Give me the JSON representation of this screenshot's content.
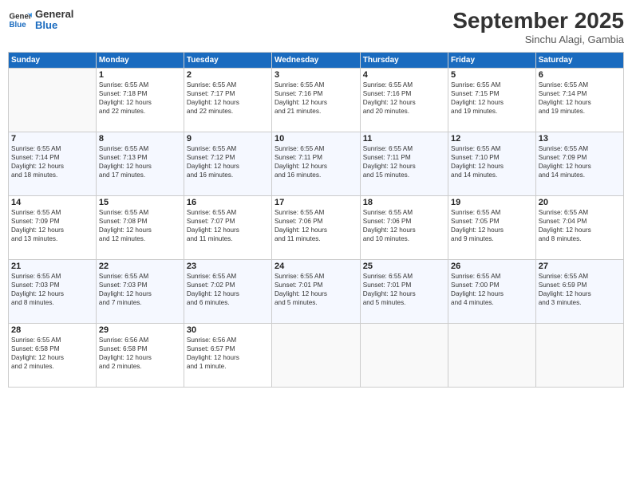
{
  "header": {
    "logo_line1": "General",
    "logo_line2": "Blue",
    "month": "September 2025",
    "location": "Sinchu Alagi, Gambia"
  },
  "weekdays": [
    "Sunday",
    "Monday",
    "Tuesday",
    "Wednesday",
    "Thursday",
    "Friday",
    "Saturday"
  ],
  "weeks": [
    [
      {
        "day": "",
        "info": ""
      },
      {
        "day": "1",
        "info": "Sunrise: 6:55 AM\nSunset: 7:18 PM\nDaylight: 12 hours\nand 22 minutes."
      },
      {
        "day": "2",
        "info": "Sunrise: 6:55 AM\nSunset: 7:17 PM\nDaylight: 12 hours\nand 22 minutes."
      },
      {
        "day": "3",
        "info": "Sunrise: 6:55 AM\nSunset: 7:16 PM\nDaylight: 12 hours\nand 21 minutes."
      },
      {
        "day": "4",
        "info": "Sunrise: 6:55 AM\nSunset: 7:16 PM\nDaylight: 12 hours\nand 20 minutes."
      },
      {
        "day": "5",
        "info": "Sunrise: 6:55 AM\nSunset: 7:15 PM\nDaylight: 12 hours\nand 19 minutes."
      },
      {
        "day": "6",
        "info": "Sunrise: 6:55 AM\nSunset: 7:14 PM\nDaylight: 12 hours\nand 19 minutes."
      }
    ],
    [
      {
        "day": "7",
        "info": "Sunrise: 6:55 AM\nSunset: 7:14 PM\nDaylight: 12 hours\nand 18 minutes."
      },
      {
        "day": "8",
        "info": "Sunrise: 6:55 AM\nSunset: 7:13 PM\nDaylight: 12 hours\nand 17 minutes."
      },
      {
        "day": "9",
        "info": "Sunrise: 6:55 AM\nSunset: 7:12 PM\nDaylight: 12 hours\nand 16 minutes."
      },
      {
        "day": "10",
        "info": "Sunrise: 6:55 AM\nSunset: 7:11 PM\nDaylight: 12 hours\nand 16 minutes."
      },
      {
        "day": "11",
        "info": "Sunrise: 6:55 AM\nSunset: 7:11 PM\nDaylight: 12 hours\nand 15 minutes."
      },
      {
        "day": "12",
        "info": "Sunrise: 6:55 AM\nSunset: 7:10 PM\nDaylight: 12 hours\nand 14 minutes."
      },
      {
        "day": "13",
        "info": "Sunrise: 6:55 AM\nSunset: 7:09 PM\nDaylight: 12 hours\nand 14 minutes."
      }
    ],
    [
      {
        "day": "14",
        "info": "Sunrise: 6:55 AM\nSunset: 7:09 PM\nDaylight: 12 hours\nand 13 minutes."
      },
      {
        "day": "15",
        "info": "Sunrise: 6:55 AM\nSunset: 7:08 PM\nDaylight: 12 hours\nand 12 minutes."
      },
      {
        "day": "16",
        "info": "Sunrise: 6:55 AM\nSunset: 7:07 PM\nDaylight: 12 hours\nand 11 minutes."
      },
      {
        "day": "17",
        "info": "Sunrise: 6:55 AM\nSunset: 7:06 PM\nDaylight: 12 hours\nand 11 minutes."
      },
      {
        "day": "18",
        "info": "Sunrise: 6:55 AM\nSunset: 7:06 PM\nDaylight: 12 hours\nand 10 minutes."
      },
      {
        "day": "19",
        "info": "Sunrise: 6:55 AM\nSunset: 7:05 PM\nDaylight: 12 hours\nand 9 minutes."
      },
      {
        "day": "20",
        "info": "Sunrise: 6:55 AM\nSunset: 7:04 PM\nDaylight: 12 hours\nand 8 minutes."
      }
    ],
    [
      {
        "day": "21",
        "info": "Sunrise: 6:55 AM\nSunset: 7:03 PM\nDaylight: 12 hours\nand 8 minutes."
      },
      {
        "day": "22",
        "info": "Sunrise: 6:55 AM\nSunset: 7:03 PM\nDaylight: 12 hours\nand 7 minutes."
      },
      {
        "day": "23",
        "info": "Sunrise: 6:55 AM\nSunset: 7:02 PM\nDaylight: 12 hours\nand 6 minutes."
      },
      {
        "day": "24",
        "info": "Sunrise: 6:55 AM\nSunset: 7:01 PM\nDaylight: 12 hours\nand 5 minutes."
      },
      {
        "day": "25",
        "info": "Sunrise: 6:55 AM\nSunset: 7:01 PM\nDaylight: 12 hours\nand 5 minutes."
      },
      {
        "day": "26",
        "info": "Sunrise: 6:55 AM\nSunset: 7:00 PM\nDaylight: 12 hours\nand 4 minutes."
      },
      {
        "day": "27",
        "info": "Sunrise: 6:55 AM\nSunset: 6:59 PM\nDaylight: 12 hours\nand 3 minutes."
      }
    ],
    [
      {
        "day": "28",
        "info": "Sunrise: 6:55 AM\nSunset: 6:58 PM\nDaylight: 12 hours\nand 2 minutes."
      },
      {
        "day": "29",
        "info": "Sunrise: 6:56 AM\nSunset: 6:58 PM\nDaylight: 12 hours\nand 2 minutes."
      },
      {
        "day": "30",
        "info": "Sunrise: 6:56 AM\nSunset: 6:57 PM\nDaylight: 12 hours\nand 1 minute."
      },
      {
        "day": "",
        "info": ""
      },
      {
        "day": "",
        "info": ""
      },
      {
        "day": "",
        "info": ""
      },
      {
        "day": "",
        "info": ""
      }
    ]
  ]
}
